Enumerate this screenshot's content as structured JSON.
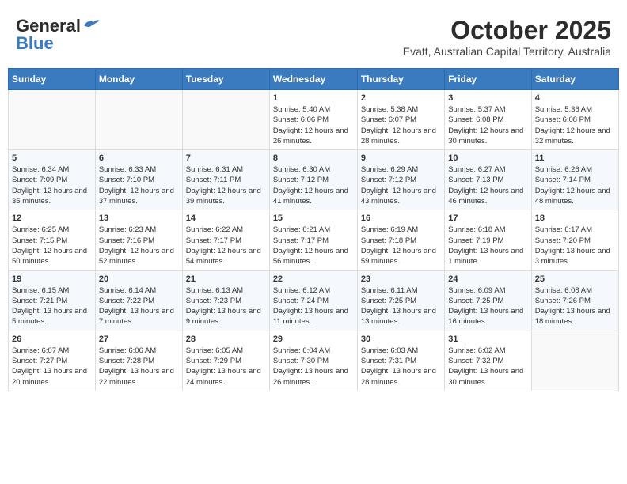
{
  "header": {
    "logo_general": "General",
    "logo_blue": "Blue",
    "month_year": "October 2025",
    "location": "Evatt, Australian Capital Territory, Australia"
  },
  "days_of_week": [
    "Sunday",
    "Monday",
    "Tuesday",
    "Wednesday",
    "Thursday",
    "Friday",
    "Saturday"
  ],
  "weeks": [
    [
      {
        "day": "",
        "info": ""
      },
      {
        "day": "",
        "info": ""
      },
      {
        "day": "",
        "info": ""
      },
      {
        "day": "1",
        "info": "Sunrise: 5:40 AM\nSunset: 6:06 PM\nDaylight: 12 hours\nand 26 minutes."
      },
      {
        "day": "2",
        "info": "Sunrise: 5:38 AM\nSunset: 6:07 PM\nDaylight: 12 hours\nand 28 minutes."
      },
      {
        "day": "3",
        "info": "Sunrise: 5:37 AM\nSunset: 6:08 PM\nDaylight: 12 hours\nand 30 minutes."
      },
      {
        "day": "4",
        "info": "Sunrise: 5:36 AM\nSunset: 6:08 PM\nDaylight: 12 hours\nand 32 minutes."
      }
    ],
    [
      {
        "day": "5",
        "info": "Sunrise: 6:34 AM\nSunset: 7:09 PM\nDaylight: 12 hours\nand 35 minutes."
      },
      {
        "day": "6",
        "info": "Sunrise: 6:33 AM\nSunset: 7:10 PM\nDaylight: 12 hours\nand 37 minutes."
      },
      {
        "day": "7",
        "info": "Sunrise: 6:31 AM\nSunset: 7:11 PM\nDaylight: 12 hours\nand 39 minutes."
      },
      {
        "day": "8",
        "info": "Sunrise: 6:30 AM\nSunset: 7:12 PM\nDaylight: 12 hours\nand 41 minutes."
      },
      {
        "day": "9",
        "info": "Sunrise: 6:29 AM\nSunset: 7:12 PM\nDaylight: 12 hours\nand 43 minutes."
      },
      {
        "day": "10",
        "info": "Sunrise: 6:27 AM\nSunset: 7:13 PM\nDaylight: 12 hours\nand 46 minutes."
      },
      {
        "day": "11",
        "info": "Sunrise: 6:26 AM\nSunset: 7:14 PM\nDaylight: 12 hours\nand 48 minutes."
      }
    ],
    [
      {
        "day": "12",
        "info": "Sunrise: 6:25 AM\nSunset: 7:15 PM\nDaylight: 12 hours\nand 50 minutes."
      },
      {
        "day": "13",
        "info": "Sunrise: 6:23 AM\nSunset: 7:16 PM\nDaylight: 12 hours\nand 52 minutes."
      },
      {
        "day": "14",
        "info": "Sunrise: 6:22 AM\nSunset: 7:17 PM\nDaylight: 12 hours\nand 54 minutes."
      },
      {
        "day": "15",
        "info": "Sunrise: 6:21 AM\nSunset: 7:17 PM\nDaylight: 12 hours\nand 56 minutes."
      },
      {
        "day": "16",
        "info": "Sunrise: 6:19 AM\nSunset: 7:18 PM\nDaylight: 12 hours\nand 59 minutes."
      },
      {
        "day": "17",
        "info": "Sunrise: 6:18 AM\nSunset: 7:19 PM\nDaylight: 13 hours\nand 1 minute."
      },
      {
        "day": "18",
        "info": "Sunrise: 6:17 AM\nSunset: 7:20 PM\nDaylight: 13 hours\nand 3 minutes."
      }
    ],
    [
      {
        "day": "19",
        "info": "Sunrise: 6:15 AM\nSunset: 7:21 PM\nDaylight: 13 hours\nand 5 minutes."
      },
      {
        "day": "20",
        "info": "Sunrise: 6:14 AM\nSunset: 7:22 PM\nDaylight: 13 hours\nand 7 minutes."
      },
      {
        "day": "21",
        "info": "Sunrise: 6:13 AM\nSunset: 7:23 PM\nDaylight: 13 hours\nand 9 minutes."
      },
      {
        "day": "22",
        "info": "Sunrise: 6:12 AM\nSunset: 7:24 PM\nDaylight: 13 hours\nand 11 minutes."
      },
      {
        "day": "23",
        "info": "Sunrise: 6:11 AM\nSunset: 7:25 PM\nDaylight: 13 hours\nand 13 minutes."
      },
      {
        "day": "24",
        "info": "Sunrise: 6:09 AM\nSunset: 7:25 PM\nDaylight: 13 hours\nand 16 minutes."
      },
      {
        "day": "25",
        "info": "Sunrise: 6:08 AM\nSunset: 7:26 PM\nDaylight: 13 hours\nand 18 minutes."
      }
    ],
    [
      {
        "day": "26",
        "info": "Sunrise: 6:07 AM\nSunset: 7:27 PM\nDaylight: 13 hours\nand 20 minutes."
      },
      {
        "day": "27",
        "info": "Sunrise: 6:06 AM\nSunset: 7:28 PM\nDaylight: 13 hours\nand 22 minutes."
      },
      {
        "day": "28",
        "info": "Sunrise: 6:05 AM\nSunset: 7:29 PM\nDaylight: 13 hours\nand 24 minutes."
      },
      {
        "day": "29",
        "info": "Sunrise: 6:04 AM\nSunset: 7:30 PM\nDaylight: 13 hours\nand 26 minutes."
      },
      {
        "day": "30",
        "info": "Sunrise: 6:03 AM\nSunset: 7:31 PM\nDaylight: 13 hours\nand 28 minutes."
      },
      {
        "day": "31",
        "info": "Sunrise: 6:02 AM\nSunset: 7:32 PM\nDaylight: 13 hours\nand 30 minutes."
      },
      {
        "day": "",
        "info": ""
      }
    ]
  ]
}
